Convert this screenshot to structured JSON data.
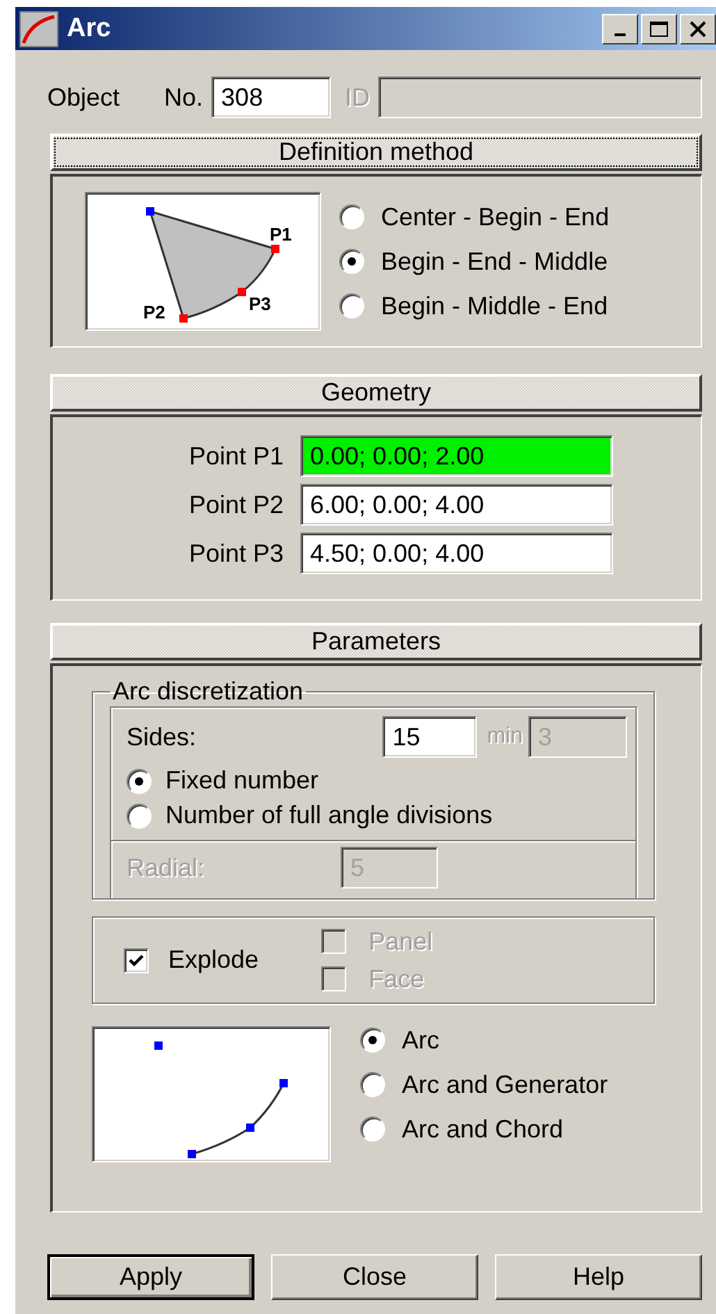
{
  "window": {
    "title": "Arc"
  },
  "object": {
    "label": "Object",
    "number_label": "No.",
    "number": "308",
    "id_label": "ID",
    "id_disabled": true
  },
  "definition": {
    "header": "Definition method",
    "focused": true,
    "diagram_labels": [
      "P1",
      "P2",
      "P3"
    ],
    "options": [
      {
        "label": "Center - Begin - End",
        "selected": false
      },
      {
        "label": "Begin - End - Middle",
        "selected": true
      },
      {
        "label": "Begin - Middle - End",
        "selected": false
      }
    ]
  },
  "geometry": {
    "header": "Geometry",
    "focused": false,
    "points": [
      {
        "label": "Point P1",
        "value": "0.00; 0.00; 2.00",
        "highlighted": true
      },
      {
        "label": "Point P2",
        "value": "6.00; 0.00; 4.00",
        "highlighted": false
      },
      {
        "label": "Point P3",
        "value": "4.50; 0.00; 4.00",
        "highlighted": false
      }
    ]
  },
  "parameters": {
    "header": "Parameters",
    "focused": false,
    "discretization": {
      "title": "Arc discretization",
      "sides_label": "Sides:",
      "sides": "15",
      "min_label": "min",
      "min": "3",
      "min_disabled": true,
      "modes": [
        {
          "label": "Fixed number",
          "selected": true
        },
        {
          "label": "Number of full angle divisions",
          "selected": false
        }
      ],
      "radial_label": "Radial:",
      "radial": "5",
      "radial_disabled": true
    },
    "explode": {
      "label": "Explode",
      "checked": true
    },
    "parts": [
      {
        "label": "Panel",
        "checked": false,
        "disabled": true
      },
      {
        "label": "Face",
        "checked": false,
        "disabled": true
      }
    ],
    "output_options": [
      {
        "label": "Arc",
        "selected": true
      },
      {
        "label": "Arc and Generator",
        "selected": false
      },
      {
        "label": "Arc and Chord",
        "selected": false
      }
    ]
  },
  "buttons": [
    {
      "label": "Apply",
      "default": true
    },
    {
      "label": "Close",
      "default": false
    },
    {
      "label": "Help",
      "default": false
    }
  ]
}
